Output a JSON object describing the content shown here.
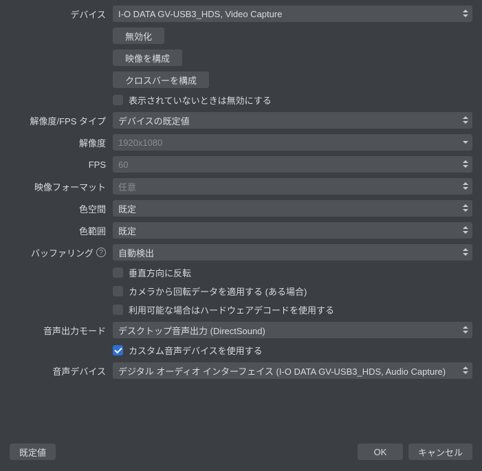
{
  "labels": {
    "device": "デバイス",
    "res_fps_type": "解像度/FPS タイプ",
    "resolution": "解像度",
    "fps": "FPS",
    "video_format": "映像フォーマット",
    "color_space": "色空間",
    "color_range": "色範囲",
    "buffering": "バッファリング",
    "audio_out_mode": "音声出力モード",
    "audio_device": "音声デバイス"
  },
  "values": {
    "device": "I-O DATA GV-USB3_HDS, Video Capture",
    "res_fps_type": "デバイスの既定値",
    "resolution_placeholder": "1920x1080",
    "fps_placeholder": "60",
    "video_format_placeholder": "任意",
    "color_space": "既定",
    "color_range": "既定",
    "buffering": "自動検出",
    "audio_out_mode": "デスクトップ音声出力 (DirectSound)",
    "audio_device": "デジタル オーディオ インターフェイス (I-O DATA GV-USB3_HDS, Audio Capture)"
  },
  "buttons": {
    "deactivate": "無効化",
    "configure_video": "映像を構成",
    "configure_crossbar": "クロスバーを構成",
    "defaults": "既定値",
    "ok": "OK",
    "cancel": "キャンセル"
  },
  "checkboxes": {
    "disable_when_not_showing": "表示されていないときは無効にする",
    "flip_vertical": "垂直方向に反転",
    "apply_rotation": "カメラから回転データを適用する (ある場合)",
    "use_hw_decode": "利用可能な場合はハードウェアデコードを使用する",
    "use_custom_audio": "カスタム音声デバイスを使用する"
  }
}
